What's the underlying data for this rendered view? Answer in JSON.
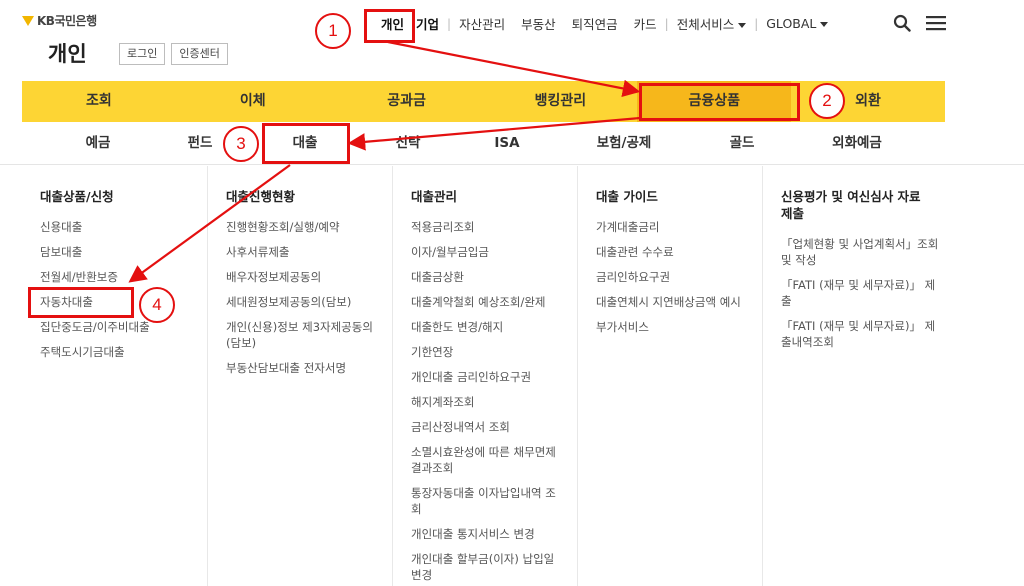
{
  "header": {
    "logo_text": "KB국민은행",
    "page_title": "개인",
    "auth_buttons": [
      "로그인",
      "인증센터"
    ],
    "gnb": [
      "개인",
      "기업",
      "자산관리",
      "부동산",
      "퇴직연금",
      "카드",
      "전체서비스",
      "GLOBAL"
    ]
  },
  "main_nav": [
    "조회",
    "이체",
    "공과금",
    "뱅킹관리",
    "금융상품",
    "외환"
  ],
  "sub_nav": [
    "예금",
    "펀드",
    "대출",
    "신탁",
    "ISA",
    "보험/공제",
    "골드",
    "외화예금"
  ],
  "mega_menu": [
    {
      "title": "대출상품/신청",
      "items": [
        "신용대출",
        "담보대출",
        "전월세/반환보증",
        "자동차대출",
        "집단중도금/이주비대출",
        "주택도시기금대출"
      ]
    },
    {
      "title": "대출진행현황",
      "items": [
        "진행현황조회/실행/예약",
        "사후서류제출",
        "배우자정보제공동의",
        "세대원정보제공동의(담보)",
        "개인(신용)정보 제3자제공동의(담보)",
        "부동산담보대출 전자서명"
      ]
    },
    {
      "title": "대출관리",
      "items": [
        "적용금리조회",
        "이자/월부금입금",
        "대출금상환",
        "대출계약철회 예상조회/완제",
        "대출한도 변경/해지",
        "기한연장",
        "개인대출 금리인하요구권",
        "해지계좌조회",
        "금리산정내역서 조회",
        "소멸시효완성에 따른 채무면제 결과조회",
        "통장자동대출 이자납입내역 조회",
        "개인대출 통지서비스 변경",
        "개인대출 할부금(이자) 납입일 변경"
      ]
    },
    {
      "title": "대출 가이드",
      "items": [
        "가계대출금리",
        "대출관련 수수료",
        "금리인하요구권",
        "대출연체시 지연배상금액 예시",
        "부가서비스"
      ]
    },
    {
      "title": "신용평가 및 여신심사 자료제출",
      "items": [
        "「업체현황 및 사업계획서」조회 및 작성",
        "「FATI (재무 및 세무자료)」 제출",
        "「FATI (재무 및 세무자료)」 제출내역조회"
      ]
    }
  ],
  "annotations": [
    "1",
    "2",
    "3",
    "4"
  ],
  "colors": {
    "brand_yellow": "#fdd534",
    "active_yellow": "#f6b71b",
    "annotation_red": "#e41010"
  }
}
